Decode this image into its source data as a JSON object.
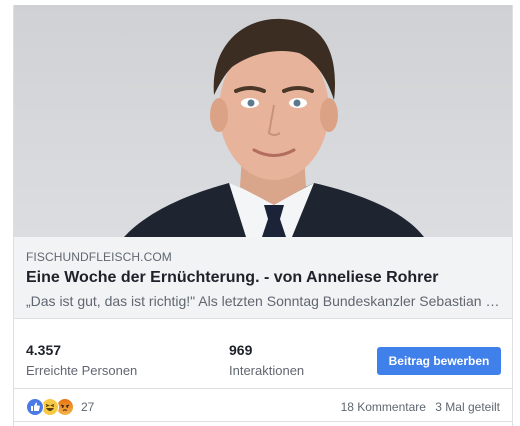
{
  "post": {
    "image_alt": "Portrait photo of a man in a dark suit and tie"
  },
  "link": {
    "domain": "FISCHUNDFLEISCH.COM",
    "title": "Eine Woche der Ernüchterung. - von Anneliese Rohrer",
    "description": "„Das ist gut, das ist richtig!\" Als letzten Sonntag Bundeskanzler Sebastian Kurz ..."
  },
  "stats": {
    "reach_value": "4.357",
    "reach_label": "Erreichte Personen",
    "engagement_value": "969",
    "engagement_label": "Interaktionen",
    "boost_label": "Beitrag bewerben"
  },
  "reactions": {
    "icons": [
      "like-icon",
      "haha-icon",
      "angry-icon"
    ],
    "count": "27",
    "comments": "18 Kommentare",
    "shares": "3 Mal geteilt"
  },
  "colors": {
    "accent": "#4080ea",
    "preview_bg": "#f2f3f5",
    "text_primary": "#1d2129",
    "text_secondary": "#606770"
  }
}
